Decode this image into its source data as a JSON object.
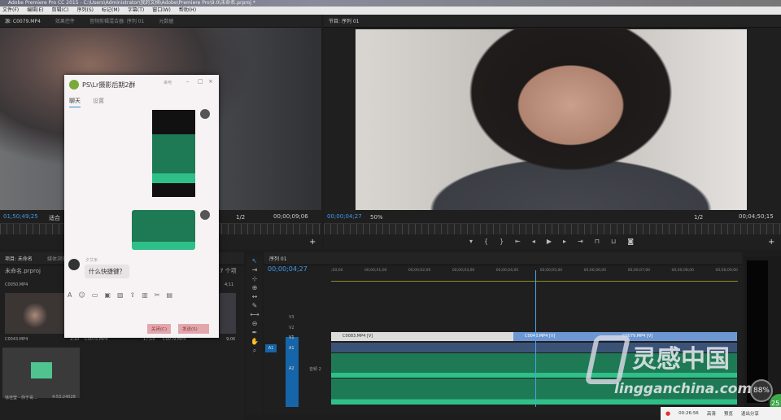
{
  "window": {
    "title": "Adobe Premiere Pro CC 2015 - C:\\Users\\Administrator\\我的文档\\Adobe\\Premiere Pro\\9.0\\未命名.prproj *"
  },
  "menu": [
    "文件(F)",
    "编辑(E)",
    "剪辑(C)",
    "序列(S)",
    "标记(M)",
    "字幕(T)",
    "窗口(W)",
    "帮助(H)"
  ],
  "source": {
    "tabs": [
      "源: C0079.MP4",
      "效果控件",
      "音频剪辑混合器: 序列 01",
      "元数据"
    ],
    "timecode": "01;50;49;25",
    "fit": "适合",
    "ratio": "1/2",
    "duration": "00;00;09;06"
  },
  "program": {
    "tab": "节目: 序列 01",
    "timecode": "00;00;04;27",
    "zoom": "50%",
    "ratio": "1/2",
    "duration": "00;04;50;15"
  },
  "project": {
    "tabs": [
      "项目: 未命名",
      "媒体浏览器"
    ],
    "file": "未命名.prproj",
    "count": "7 个项",
    "items": [
      {
        "name": "C0050.MP4",
        "dur": "4;11"
      },
      {
        "name": "C0043.MP4",
        "dur": "2;10"
      },
      {
        "name": "C0075.MP4",
        "dur": "17;15"
      },
      {
        "name": "C0079.MP4",
        "dur": "9;06"
      },
      {
        "name": "徐佳莹 - 你于哥...",
        "dur": "4:53:24028"
      }
    ]
  },
  "timeline": {
    "tab": "序列 01",
    "timecode": "00;00;04;27",
    "ruler": [
      ";00;00",
      "00;00;01;00",
      "00;00;02;00",
      "00;00;03;00",
      "00;00;04;00",
      "00;00;05;00",
      "00;00;06;00",
      "00;00;07;00",
      "00;00;08;00",
      "00;00;09;00"
    ],
    "tracks": [
      "V3",
      "V2",
      "V1",
      "A1",
      "A2"
    ],
    "src_a1": "A1",
    "a2_name": "音频 2",
    "clips": [
      "C0083.MP4 [V]",
      "C0043.MP4 [V]",
      "C0079.MP4 [V]"
    ]
  },
  "chat": {
    "title": "PS\\Lr摄影后期2群",
    "status": "来吧",
    "tabs": [
      "聊天",
      "设置"
    ],
    "sender": "夕艾米",
    "message": "什么快捷键？",
    "close": "关闭(C)",
    "send": "发送(S)"
  },
  "watermark": {
    "brand": "灵感中国",
    "url": "lingganchina.com"
  },
  "overlay": {
    "percent": "88%",
    "badge": "25"
  },
  "status": {
    "time": "00:26:56",
    "items": [
      "高清",
      "预览",
      "退出分享"
    ]
  },
  "colors": {
    "accent": "#3d9be9",
    "audio": "#1e7a55",
    "clip_blue": "#6d97d2"
  }
}
